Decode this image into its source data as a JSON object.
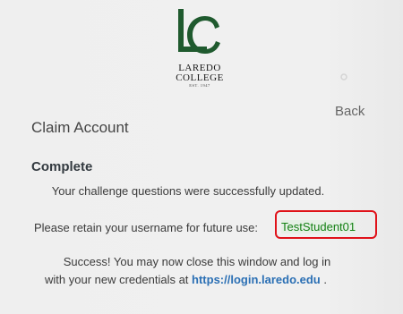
{
  "brand": {
    "name_line1": "LAREDO",
    "name_line2": "COLLEGE",
    "established": "EST. 1947",
    "logo_color": "#1f5a2e"
  },
  "nav": {
    "back_label": "Back"
  },
  "page": {
    "title": "Claim Account",
    "status_heading": "Complete",
    "message_updated": "Your challenge questions were successfully updated.",
    "retain_prompt": "Please retain your username for future use:",
    "username": "TestStudent01",
    "success_line1": "Success! You may now close this window and log in",
    "success_line2_prefix": "with your new credentials at ",
    "login_url": "https://login.laredo.edu",
    "success_line2_suffix": " ."
  },
  "colors": {
    "highlight_border": "#e0121a",
    "username_text": "#138013",
    "link": "#2a6fb4"
  }
}
